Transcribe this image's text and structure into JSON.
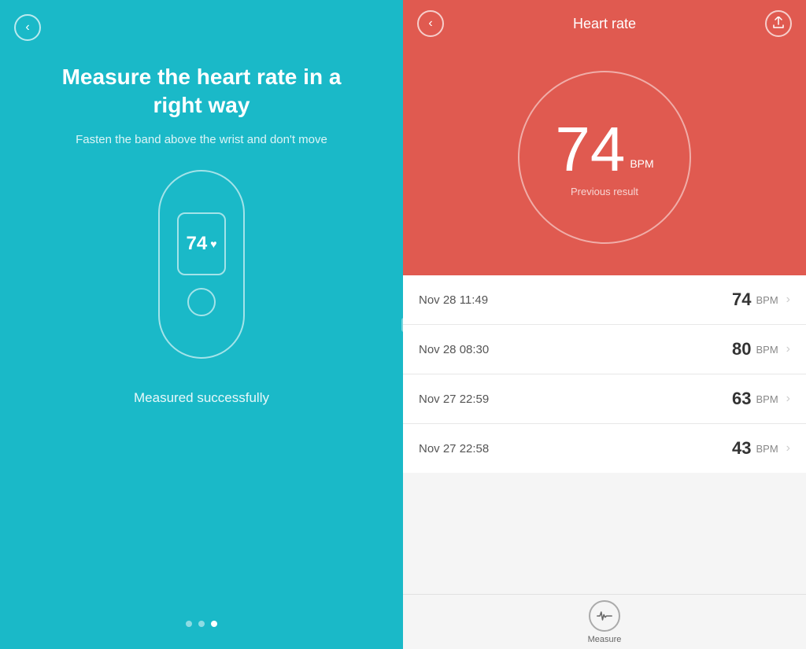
{
  "left": {
    "title": "Measure the heart rate in a right way",
    "subtitle": "Fasten the band above the wrist and don't move",
    "band_display": "74",
    "measured_text": "Measured successfully",
    "dots": [
      "inactive",
      "inactive",
      "active"
    ],
    "back_icon": "‹"
  },
  "right": {
    "header": {
      "title": "Heart rate",
      "back_icon": "‹",
      "share_icon": "⏏"
    },
    "display": {
      "bpm_value": "74",
      "bpm_unit": "BPM",
      "previous_result_label": "Previous result"
    },
    "history": [
      {
        "time": "Nov 28 11:49",
        "bpm": "74",
        "unit": "BPM"
      },
      {
        "time": "Nov 28 08:30",
        "bpm": "80",
        "unit": "BPM"
      },
      {
        "time": "Nov 27 22:59",
        "bpm": "63",
        "unit": "BPM"
      },
      {
        "time": "Nov 27 22:58",
        "bpm": "43",
        "unit": "BPM"
      }
    ],
    "measure_button_label": "Measure"
  }
}
